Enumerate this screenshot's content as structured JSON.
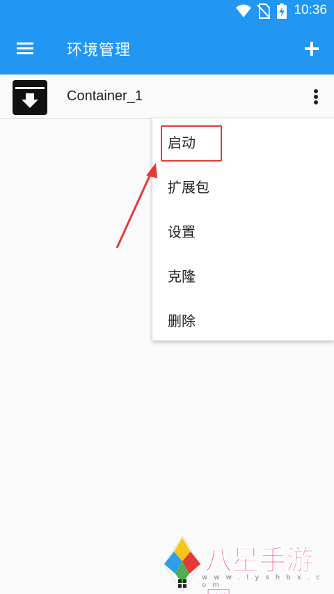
{
  "status_bar": {
    "time": "10:36",
    "icons": [
      "wifi-icon",
      "no-sim-icon",
      "battery-charging-icon"
    ]
  },
  "app_bar": {
    "title": "环境管理",
    "menu_icon": "hamburger-menu-icon",
    "add_icon": "plus-icon",
    "color": "#2196f3"
  },
  "list": {
    "items": [
      {
        "name": "Container_1",
        "icon": "archive-download-icon",
        "more_icon": "more-vert-icon"
      }
    ]
  },
  "popup_menu": {
    "items": [
      {
        "label": "启动"
      },
      {
        "label": "扩展包"
      },
      {
        "label": "设置"
      },
      {
        "label": "克隆"
      },
      {
        "label": "删除"
      }
    ]
  },
  "annotation": {
    "highlight_color": "#e53935"
  },
  "watermark": {
    "text": "八星手游网",
    "url": "w w w . l y s h b x . c o m"
  }
}
